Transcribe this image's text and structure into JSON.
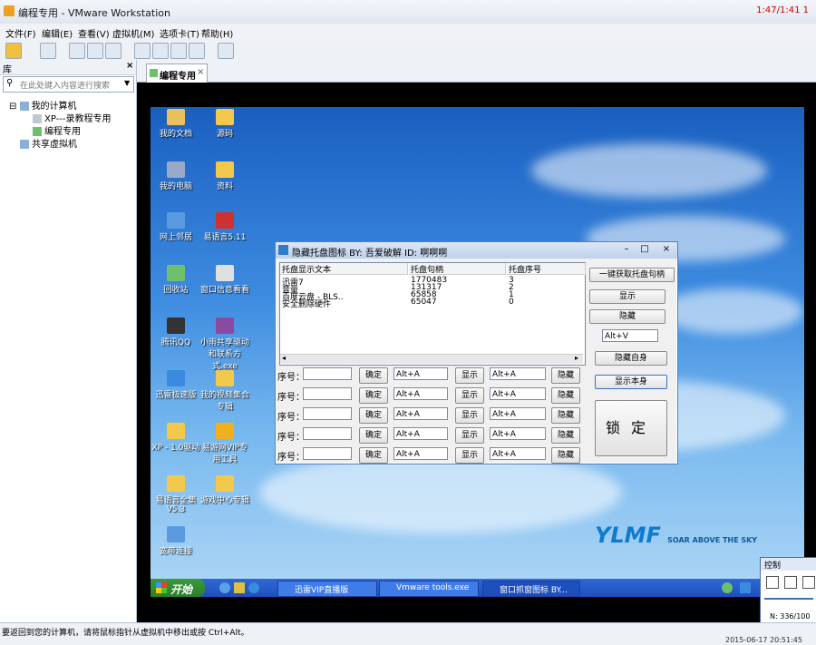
{
  "window": {
    "title": "编程专用 - VMware Workstation",
    "corner_text": "1:47/1:41 1"
  },
  "menu": [
    {
      "label": "文件(F)"
    },
    {
      "label": "编辑(E)"
    },
    {
      "label": "查看(V)"
    },
    {
      "label": "虚拟机(M)"
    },
    {
      "label": "选项卡(T)"
    },
    {
      "label": "帮助(H)"
    }
  ],
  "sidebar": {
    "title": "库",
    "search_placeholder": "在此处键入内容进行搜索",
    "tree": [
      {
        "label": "我的计算机"
      },
      {
        "label": "XP---录教程专用"
      },
      {
        "label": "编程专用"
      },
      {
        "label": "共享虚拟机"
      }
    ]
  },
  "tab": {
    "label": "编程专用"
  },
  "desktop_icons": [
    {
      "label": "我的文档",
      "color": "#e8c060"
    },
    {
      "label": "源码",
      "color": "#f2c94c"
    },
    {
      "label": "我的电脑",
      "color": "#9aa9c8"
    },
    {
      "label": "资料",
      "color": "#f2c94c"
    },
    {
      "label": "网上邻居",
      "color": "#5a9ae0"
    },
    {
      "label": "易语言5.11",
      "color": "#d03030"
    },
    {
      "label": "回收站",
      "color": "#6fbf6f"
    },
    {
      "label": "窗口信息看看",
      "color": "#e0e0e0"
    },
    {
      "label": "腾讯QQ",
      "color": "#333333"
    },
    {
      "label": "小雨共享驱动和联系方式.exe",
      "color": "#8a4aa0"
    },
    {
      "label": "迅雷极速版",
      "color": "#3a8ae0"
    },
    {
      "label": "我的视频集合专辑",
      "color": "#f2c94c"
    },
    {
      "label": "XP - 1.0驱动",
      "color": "#f2c94c"
    },
    {
      "label": "易游网VIP专用工具",
      "color": "#f0b020"
    },
    {
      "label": "易语言全集V5.3",
      "color": "#f2c94c"
    },
    {
      "label": "游戏中心专辑",
      "color": "#f2c94c"
    },
    {
      "label": "宽带连接",
      "color": "#5a9ae0"
    }
  ],
  "taskbar": {
    "start": "开始",
    "items": [
      {
        "label": "迅雷VIP直播版"
      },
      {
        "label": "Vmware tools.exe"
      },
      {
        "label": "窗口抓窗图标 BY..."
      }
    ]
  },
  "app": {
    "title": "隐藏托盘图标 BY: 吾爱破解 ID: 啊啊啊",
    "columns": [
      "托盘显示文本",
      "托盘句柄",
      "托盘序号"
    ],
    "rows": [
      {
        "text": "迅雷7",
        "handle": "1770483",
        "index": "3"
      },
      {
        "text": "音量",
        "handle": "131317",
        "index": "2"
      },
      {
        "text": "百度云盘 - BLS..",
        "handle": "65858",
        "index": "1"
      },
      {
        "text": "安全删除硬件",
        "handle": "65047",
        "index": "0"
      }
    ],
    "right_buttons": {
      "get_all": "一键获取托盘句柄",
      "show": "显示",
      "hide": "隐藏",
      "hide_self": "隐藏自身",
      "show_self": "显示本身",
      "hotkey": "Alt+V",
      "lock": "锁定"
    },
    "slot_label": "序号：",
    "slot_confirm": "确定",
    "slot_show": "显示",
    "slot_hide": "隐藏",
    "slot_hotkey": "Alt+A",
    "slots": [
      {
        "id": 1
      },
      {
        "id": 2
      },
      {
        "id": 3
      },
      {
        "id": 4
      },
      {
        "id": 5
      }
    ]
  },
  "branding": {
    "ymf": "YLMF",
    "slogan": "SOAR ABOVE THE SKY"
  },
  "ctrl_panel": {
    "title": "控制",
    "progress": "N: 336/100"
  },
  "statusbar": {
    "message": "要返回到您的计算机，请将鼠标指针从虚拟机中移出或按 Ctrl+Alt。",
    "date": "2015-06-17 20:51:45"
  }
}
